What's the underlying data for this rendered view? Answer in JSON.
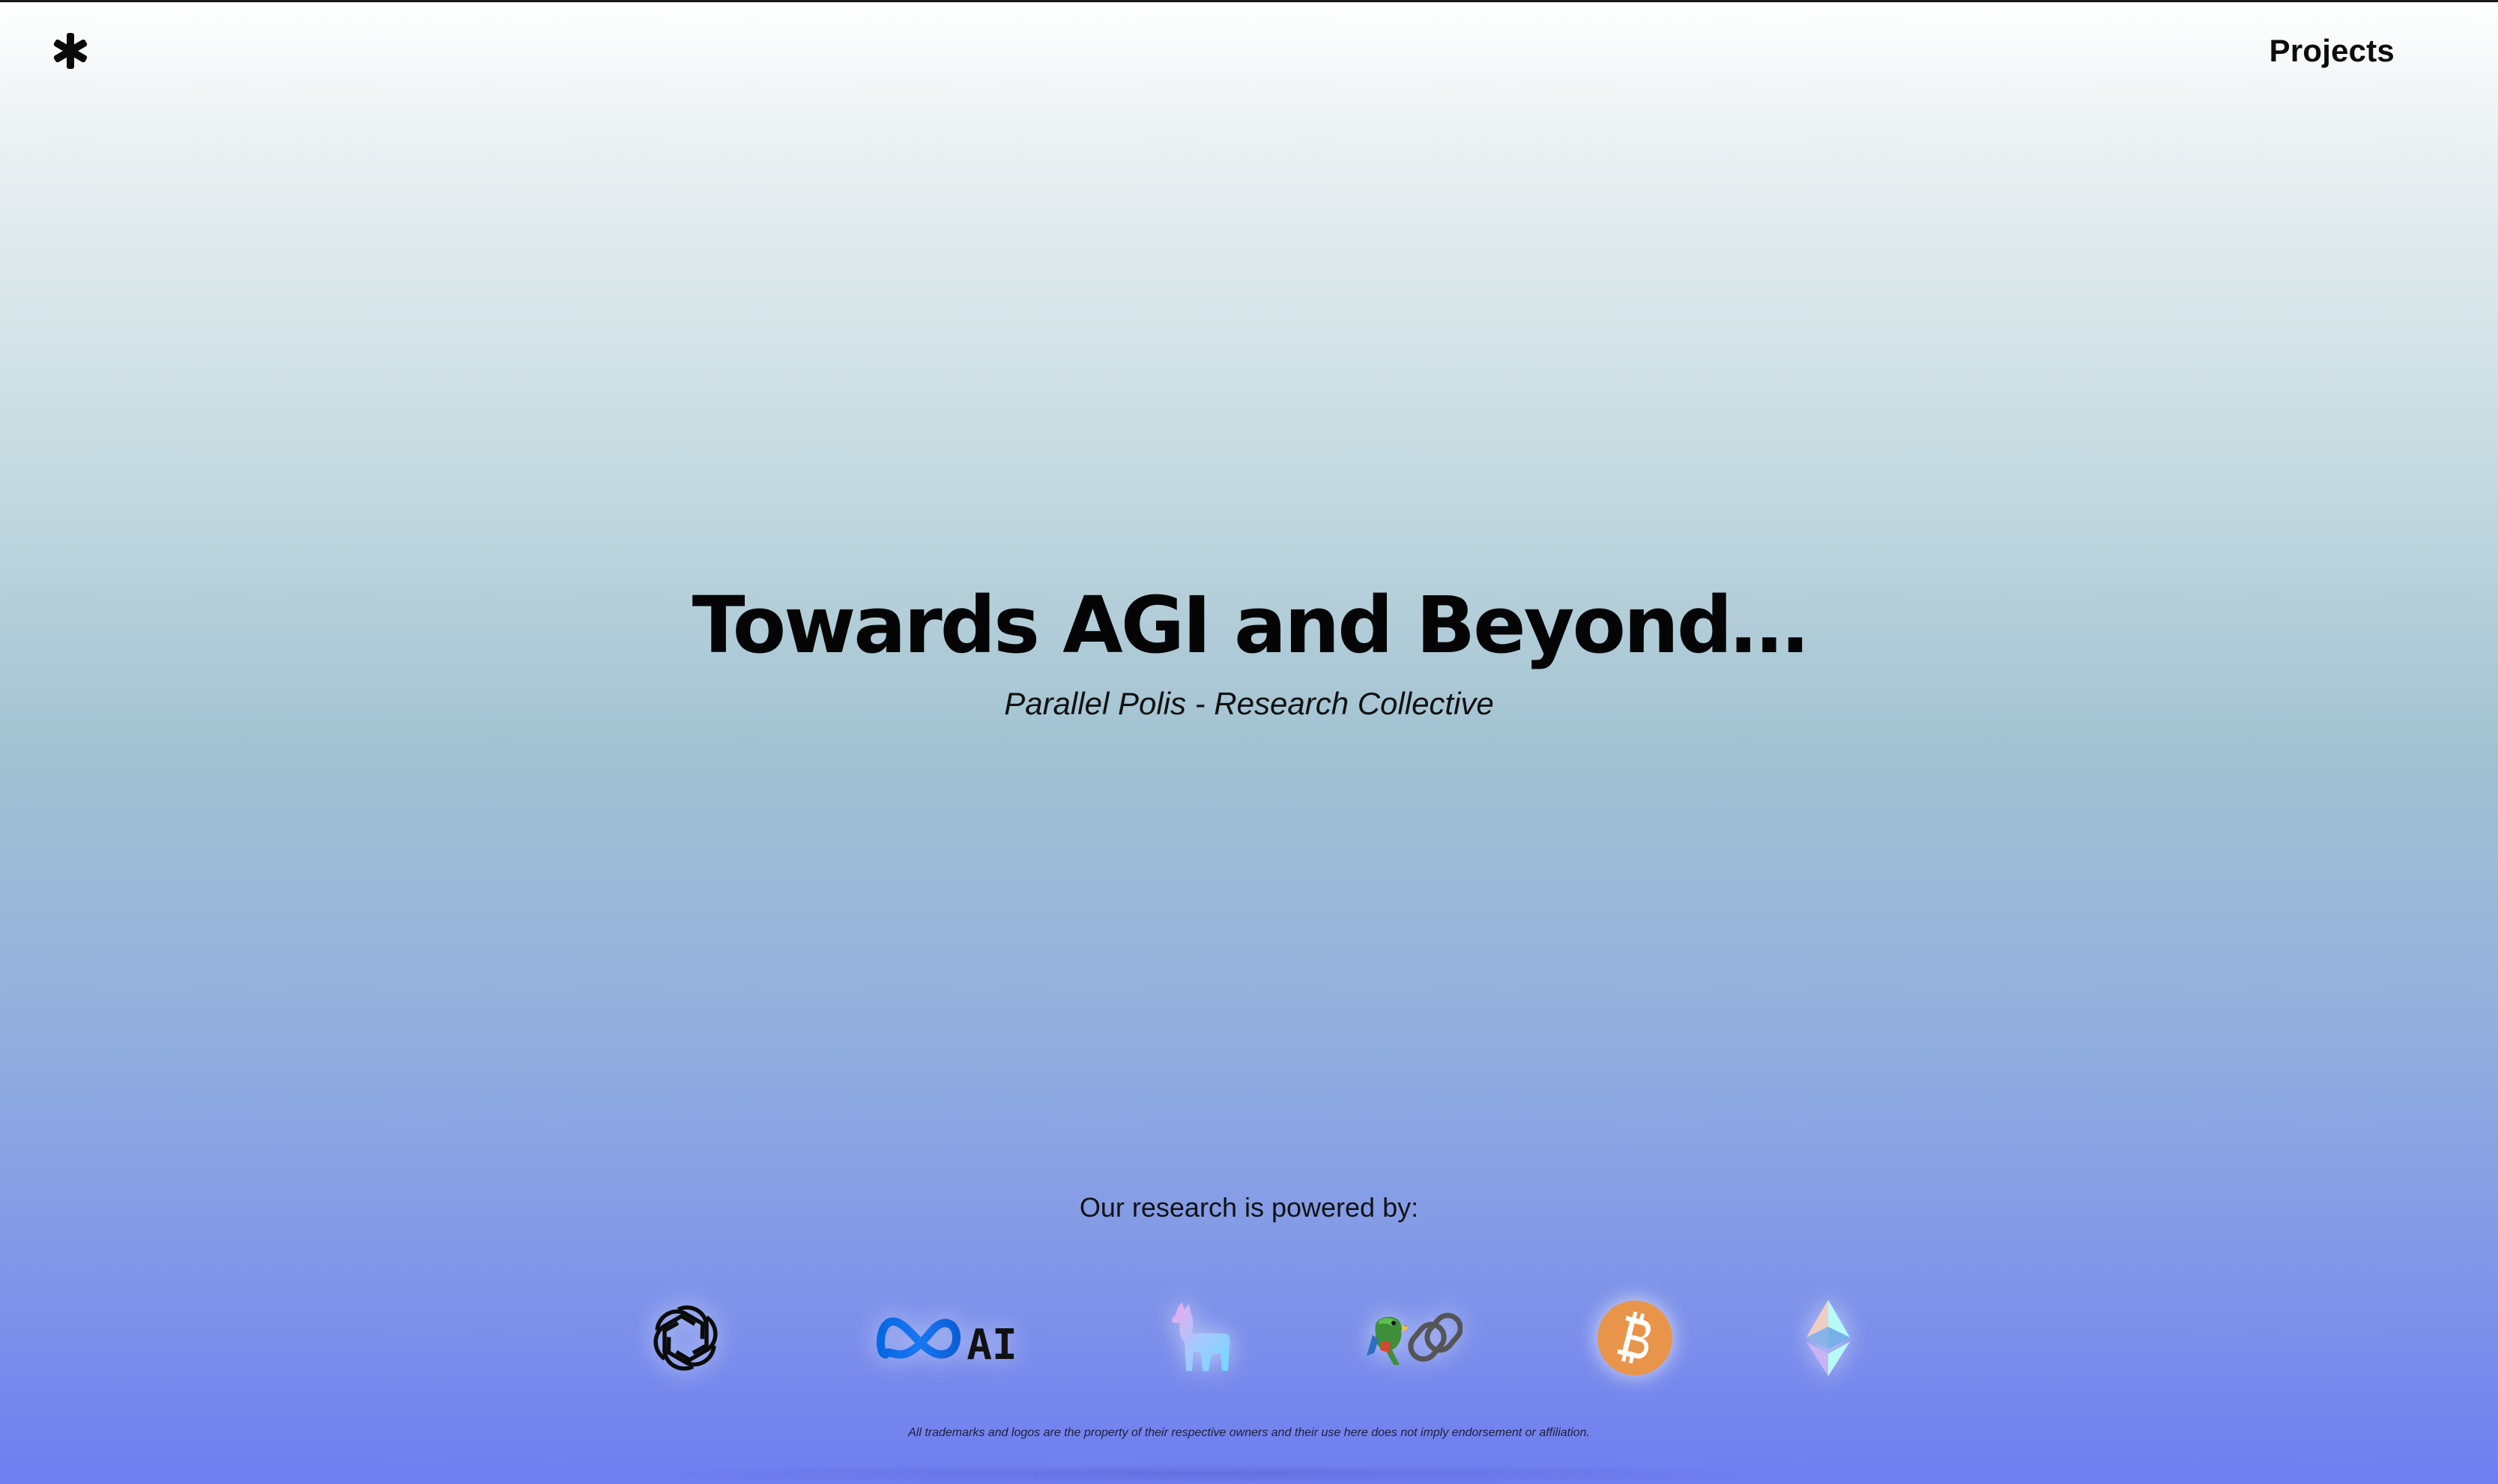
{
  "header": {
    "logo_icon": "asterisk-icon",
    "nav": {
      "projects_label": "Projects"
    }
  },
  "hero": {
    "title": "Towards AGI and Beyond…",
    "subtitle": "Parallel Polis - Research Collective"
  },
  "powered_by": {
    "heading": "Our research is powered by:",
    "logos": [
      {
        "name": "openai-icon"
      },
      {
        "name": "meta-ai-icon",
        "text": "AI",
        "color": "#1877F2"
      },
      {
        "name": "llama-icon"
      },
      {
        "name": "langchain-icon"
      },
      {
        "name": "bitcoin-icon",
        "color": "#F7931A"
      },
      {
        "name": "ethereum-icon"
      }
    ]
  },
  "footer": {
    "disclaimer": "All trademarks and logos are the property of their respective owners and their use here does not imply endorsement or affiliation."
  },
  "colors": {
    "gradient_top": "#ffffff",
    "gradient_bottom": "#6f7ef0",
    "text": "#0a0a0a"
  }
}
